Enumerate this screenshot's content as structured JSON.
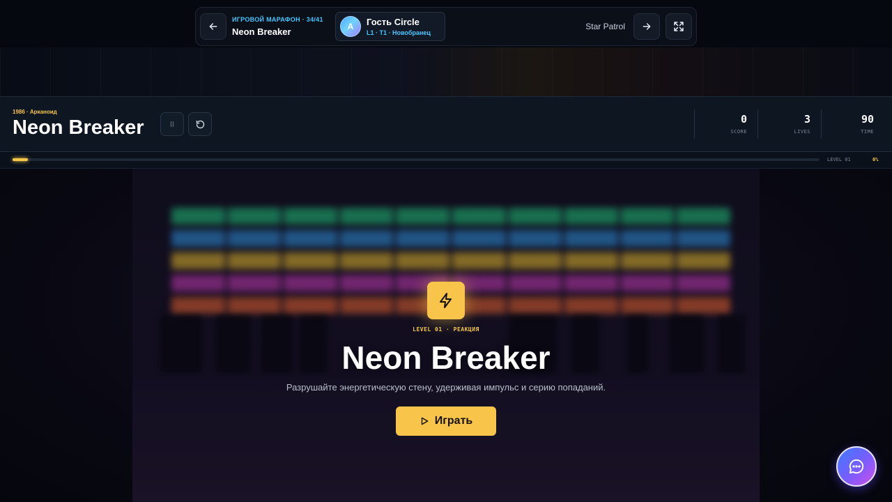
{
  "topbar": {
    "marathon_label": "ИГРОВОЙ МАРАФОН · 34/41",
    "current_game": "Neon Breaker",
    "user": {
      "initial": "A",
      "name": "Гость Circle",
      "rank": "L1 · T1 · Новобранец"
    },
    "next_game": "Star Patrol"
  },
  "game_header": {
    "eyebrow": "1986 · Арканоид",
    "title": "Neon Breaker",
    "stats": [
      {
        "value": "0",
        "label": "SCORE"
      },
      {
        "value": "3",
        "label": "LIVES"
      },
      {
        "value": "90",
        "label": "TIME"
      }
    ],
    "level_label": "LEVEL 01",
    "progress_text": "0%",
    "progress_value": 0
  },
  "overlay": {
    "kicker": "LEVEL 01 · РЕАКЦИЯ",
    "title": "Neon Breaker",
    "description": "Разрушайте энергетическую стену, удерживая импульс и серию попаданий.",
    "play_label": "Играть"
  },
  "colors": {
    "accent": "#f8c54a",
    "cyan": "#3fc7ff",
    "brick_rows": [
      "#1fbf7a",
      "#2e8fd8",
      "#e0b52e",
      "#c03ab0",
      "#e0602e"
    ]
  },
  "icons": {
    "back": "arrow-left-icon",
    "next": "arrow-right-icon",
    "fullscreen": "fullscreen-icon",
    "pause": "pause-icon",
    "restart": "restart-icon",
    "badge": "lightning-icon",
    "play": "play-icon",
    "chat": "chat-icon"
  }
}
